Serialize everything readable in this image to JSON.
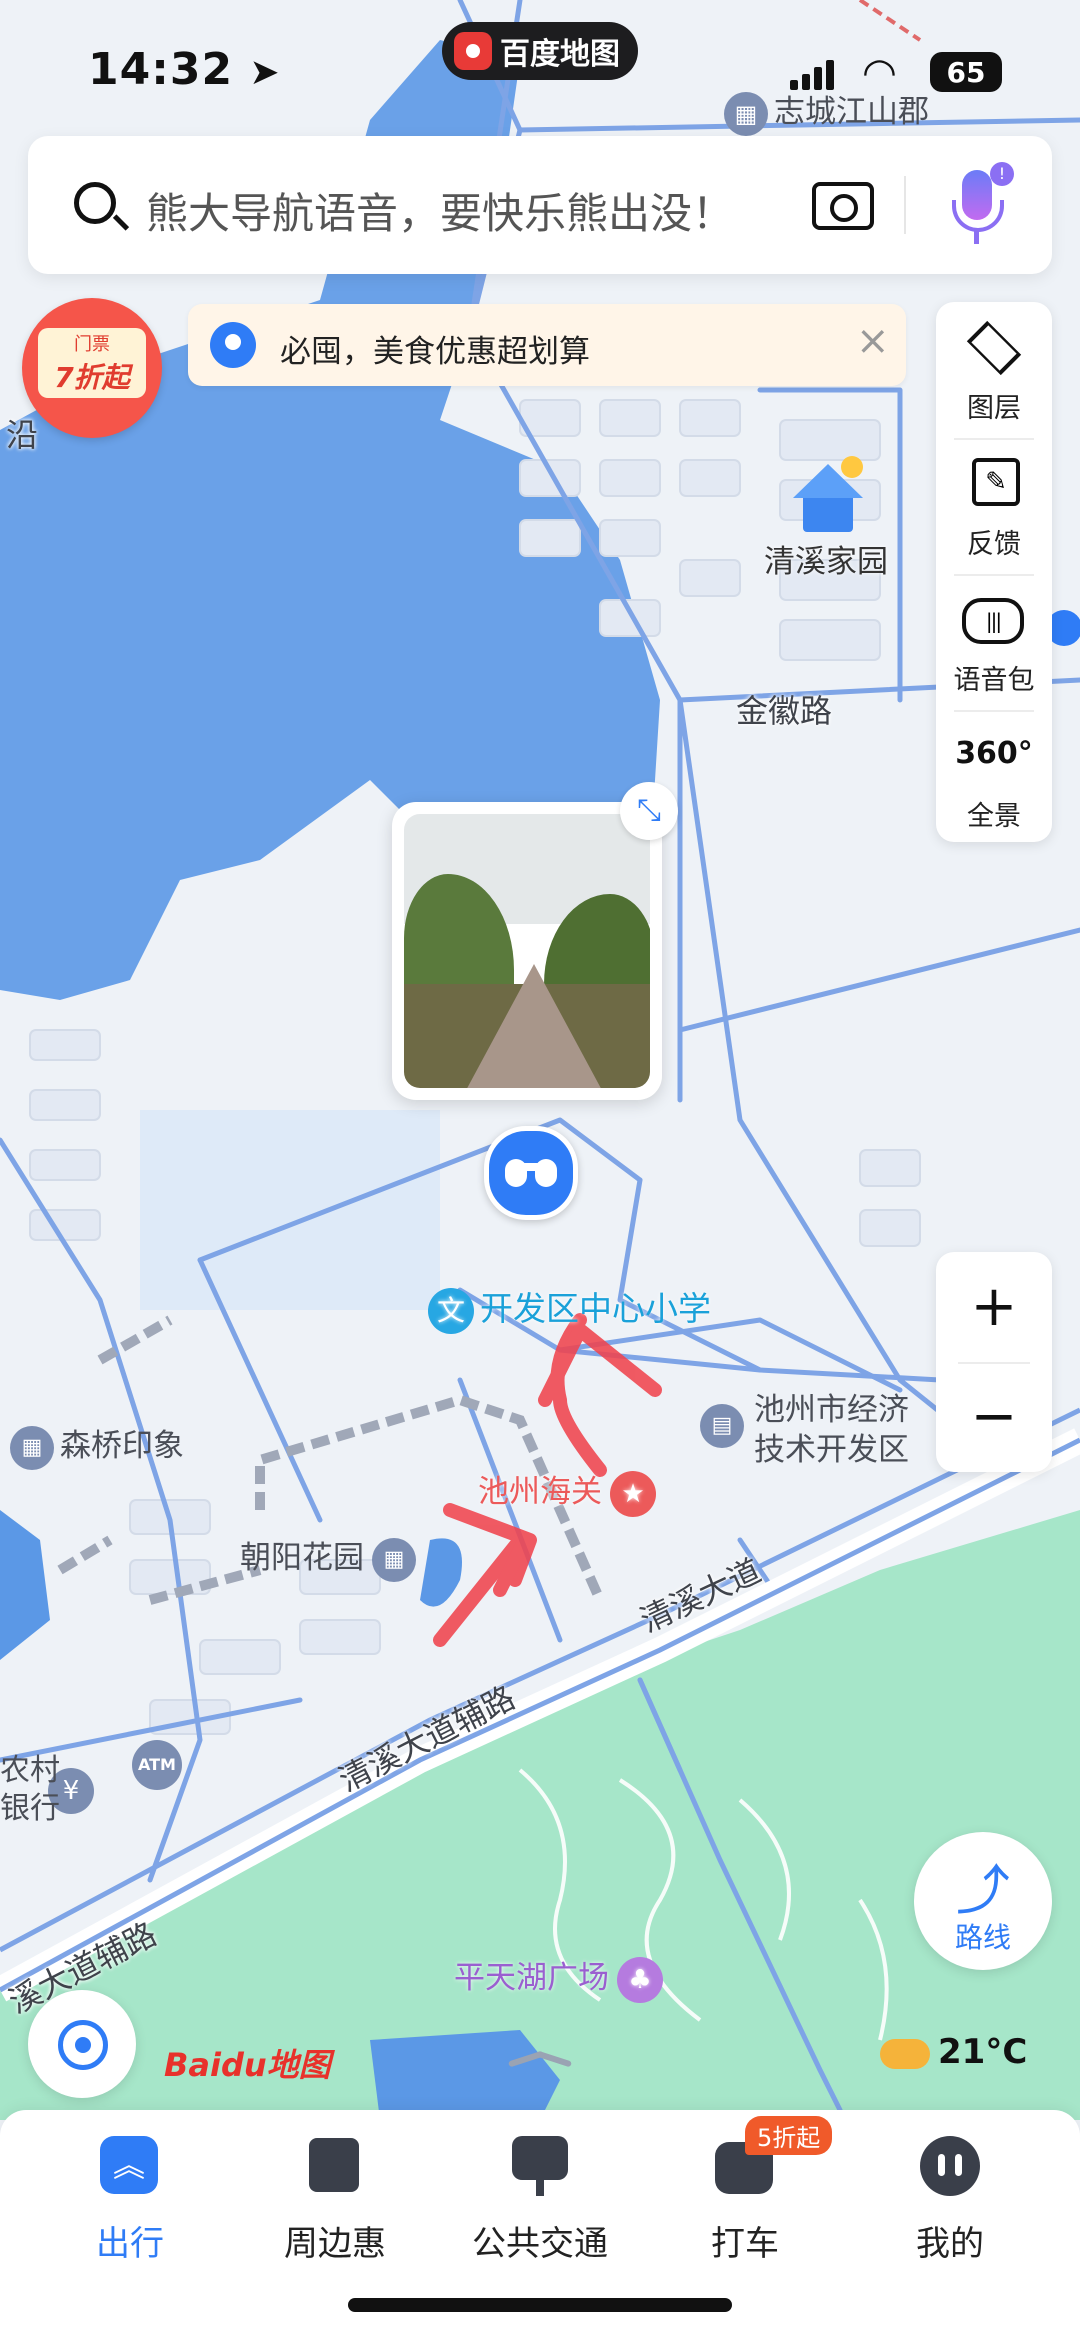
{
  "status_bar": {
    "time": "14:32",
    "app_name": "百度地图",
    "battery": "65"
  },
  "search": {
    "placeholder": "熊大导航语音，要快乐熊出没！"
  },
  "promo": {
    "badge_top": "门票",
    "badge_main": "7折起",
    "banner_text": "必囤，美食优惠超划算"
  },
  "toolbox": {
    "layers": "图层",
    "feedback": "反馈",
    "voice_pack": "语音包",
    "panorama_number": "360°",
    "panorama": "全景"
  },
  "map": {
    "labels": {
      "zhicheng": "志城江山郡",
      "qingxi_home": "清溪家园",
      "jinhui_road": "金徽路",
      "school": "开发区中心小学",
      "dev_zone_line1": "池州市经济",
      "dev_zone_line2": "技术开发区",
      "senqiao": "森桥印象",
      "customs": "池州海关",
      "chaoyang": "朝阳花园",
      "qingxi_avenue": "清溪大道",
      "qingxi_aux": "清溪大道辅路",
      "qingxi_aux_left": "溪大道辅路",
      "pingtian": "平天湖广场",
      "bank_partial_1": "农村",
      "bank_partial_2": "银行",
      "road_left_top": "沿"
    },
    "colors": {
      "water": "#5b98e6",
      "park": "#a6e6c9",
      "road": "#7ea4e6",
      "land": "#eef2f7"
    }
  },
  "controls": {
    "route": "路线",
    "weather": "21°C",
    "logo": "Baidu地图"
  },
  "tabbar": {
    "tabs": [
      {
        "label": "出行",
        "active": true
      },
      {
        "label": "周边惠",
        "active": false
      },
      {
        "label": "公共交通",
        "active": false
      },
      {
        "label": "打车",
        "active": false
      },
      {
        "label": "我的",
        "active": false
      }
    ],
    "taxi_badge": "5折起"
  },
  "accent": "#2f7cf6"
}
